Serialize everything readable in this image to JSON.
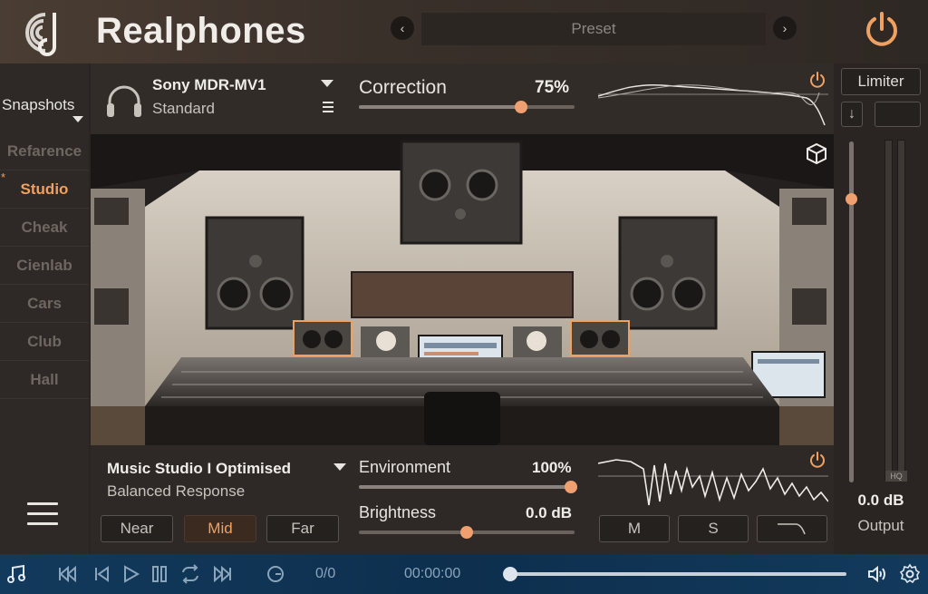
{
  "header": {
    "app_title": "Realphones",
    "preset_label": "Preset",
    "prev_glyph": "‹",
    "next_glyph": "›",
    "accent_color": "#f0a060"
  },
  "sidebar": {
    "title": "Snapshots",
    "items": [
      {
        "label": "Refarence",
        "active": false
      },
      {
        "label": "Studio",
        "active": true
      },
      {
        "label": "Cheak",
        "active": false
      },
      {
        "label": "Cienlab",
        "active": false
      },
      {
        "label": "Cars",
        "active": false
      },
      {
        "label": "Club",
        "active": false
      },
      {
        "label": "Hall",
        "active": false
      }
    ],
    "star_glyph": "*"
  },
  "headphones": {
    "model": "Sony MDR-MV1",
    "profile": "Standard",
    "correction_label": "Correction",
    "correction_value": "75%",
    "correction_fraction": 0.75
  },
  "room": {
    "name": "Music Studio I Optimised",
    "profile": "Balanced Response",
    "environment_label": "Environment",
    "environment_value": "100%",
    "environment_fraction": 1.0,
    "brightness_label": "Brightness",
    "brightness_value": "0.0 dB",
    "brightness_fraction": 0.5,
    "distance_buttons": [
      {
        "label": "Near",
        "active": false
      },
      {
        "label": "Mid",
        "active": true
      },
      {
        "label": "Far",
        "active": false
      }
    ],
    "mode_buttons": [
      "M",
      "S"
    ]
  },
  "output": {
    "limiter_label": "Limiter",
    "down_glyph": "↓",
    "hq_label": "HQ",
    "value": "0.0 dB",
    "label": "Output",
    "level_fraction": 0.83
  },
  "transport": {
    "count": "0/0",
    "time": "00:00:00",
    "bg_color": "#0e2f4e"
  }
}
